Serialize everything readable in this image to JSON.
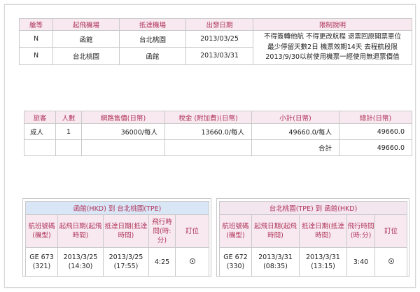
{
  "fare_rules": {
    "headers": [
      "艙等",
      "起飛機場",
      "抵達機場",
      "出發日期",
      "限制說明"
    ],
    "rows": [
      {
        "class": "N",
        "from": "函館",
        "to": "台北桃園",
        "date": "2013/03/25"
      },
      {
        "class": "N",
        "from": "台北桃園",
        "to": "函館",
        "date": "2013/03/31"
      }
    ],
    "notes": [
      "不得簽轉他航 不得更改航程 退票回原開票單位",
      "最少停留天數2日 機票效期14天 去程航段限",
      "2013/9/30以前使用機票一經使用無退票價值"
    ]
  },
  "price": {
    "headers": [
      "旅客",
      "人數",
      "網路售價(日幣)",
      "稅金 (附加費)(日幣)",
      "小計(日幣)",
      "總計(日幣)"
    ],
    "row": {
      "passenger": "成人",
      "count": "1",
      "price": "36000/每人",
      "tax": "13660.0/每人",
      "subtotal": "49660.0/每人",
      "total": "49660.0"
    },
    "sum_label": "合計",
    "sum_value": "49660.0"
  },
  "outbound": {
    "title": "函館(HKD) 到 台北桃園(TPE)",
    "headers": [
      "航班號碼(機型)",
      "起飛日期(起飛時間)",
      "抵達日期(抵達時間)",
      "飛行時間(時:分)",
      "訂位"
    ],
    "flight": {
      "number": "GE 673",
      "type": "(321)",
      "dep_date": "2013/3/25",
      "dep_time": "(14:30)",
      "arr_date": "2013/3/25",
      "arr_time": "(17:55)",
      "duration": "4:25"
    }
  },
  "inbound": {
    "title": "台北桃園(TPE) 到 函館(HKD)",
    "headers": [
      "航班號碼(機型)",
      "起飛日期(起飛時間)",
      "抵達日期(抵達時間)",
      "飛行時間(時:分)",
      "訂位"
    ],
    "flight": {
      "number": "GE 672",
      "type": "(330)",
      "dep_date": "2013/3/31",
      "dep_time": "(08:35)",
      "arr_date": "2013/3/31",
      "arr_time": "(13:15)",
      "duration": "3:40"
    }
  },
  "colors": {
    "header_text": "#b0335b",
    "header_bg_pink": "#f7e9ef",
    "header_bg_blue": "#d9e6f6"
  }
}
